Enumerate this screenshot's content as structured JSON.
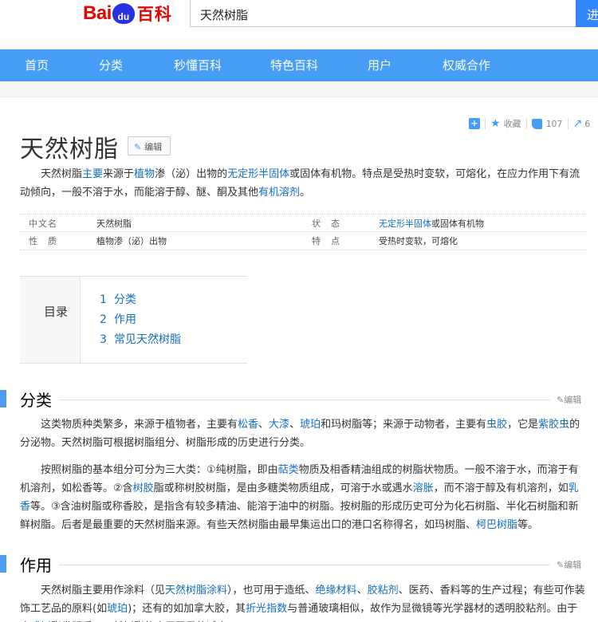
{
  "header": {
    "logo_bai": "Bai",
    "logo_du": "du",
    "logo_baike": "百科",
    "search_value": "天然树脂",
    "search_button": "进"
  },
  "nav": {
    "items": [
      "首页",
      "分类",
      "秒懂百科",
      "特色百科",
      "用户",
      "权威合作"
    ]
  },
  "toolbar": {
    "plus": "+",
    "collect": "收藏",
    "likes": "107",
    "shares": "6"
  },
  "article": {
    "title": "天然树脂",
    "edit": "编辑",
    "summary": [
      {
        "t": "天然树脂"
      },
      {
        "t": "主要",
        "link": true
      },
      {
        "t": "来源于"
      },
      {
        "t": "植物",
        "link": true
      },
      {
        "t": "渗（泌）出物的"
      },
      {
        "t": "无定形半固体",
        "link": true
      },
      {
        "t": "或固体有机物。特点是受热时变软，可熔化，在应力作用下有流动倾向，一般不溶于水，而能溶于醇、醚、酮及其他"
      },
      {
        "t": "有机溶剂",
        "link": true
      },
      {
        "t": "。"
      }
    ]
  },
  "basic_info": {
    "rows": [
      {
        "k1": "中文名",
        "v1": "天然树脂",
        "k2": "状　态",
        "v2_link": "无定形半固体",
        "v2_rest": "或固体有机物"
      },
      {
        "k1": "性　质",
        "v1": "植物渗（泌）出物",
        "k2": "特　点",
        "v2_link": "",
        "v2_rest": "受热时变软，可熔化"
      }
    ]
  },
  "catalog": {
    "title": "目录",
    "items": [
      {
        "num": "1",
        "label": "分类"
      },
      {
        "num": "2",
        "label": "作用"
      },
      {
        "num": "3",
        "label": "常见天然树脂"
      }
    ]
  },
  "sections": {
    "classification": {
      "title": "分类",
      "edit": "编辑",
      "p1": [
        {
          "t": "这类物质种类繁多，来源于植物者，主要有"
        },
        {
          "t": "松香",
          "link": true
        },
        {
          "t": "、"
        },
        {
          "t": "大漆",
          "link": true
        },
        {
          "t": "、"
        },
        {
          "t": "琥珀",
          "link": true
        },
        {
          "t": "和玛树脂等；来源于动物者，主要有"
        },
        {
          "t": "虫胶",
          "link": true
        },
        {
          "t": "，它是"
        },
        {
          "t": "紫胶虫",
          "link": true
        },
        {
          "t": "的分泌物。天然树脂可根据树脂组分、树脂形成的历史进行分类。"
        }
      ],
      "p2": [
        {
          "t": "按照树脂的基本组分可分为三大类：①纯树脂，即由"
        },
        {
          "t": "萜类",
          "link": true
        },
        {
          "t": "物质及相香精油组成的树脂状物质。一般不溶于水，而溶于有机溶剂，如松香等。②含"
        },
        {
          "t": "树胶",
          "link": true
        },
        {
          "t": "脂或称树胶树脂，是由多糖类物质组成，可溶于水或遇水"
        },
        {
          "t": "溶胀",
          "link": true
        },
        {
          "t": "，而不溶于醇及有机溶剂，如"
        },
        {
          "t": "乳香",
          "link": true
        },
        {
          "t": "等。③含油树脂或称香胶，是指含有较多精油、能溶于油中的树脂。按树脂的形成历史可分为化石树脂、半化石树脂和新鲜树脂。后者是最重要的天然树脂来源。有些天然树脂由最早集运出口的港口名称得名，如玛树脂、"
        },
        {
          "t": "柯巴树脂",
          "link": true
        },
        {
          "t": "等。"
        }
      ]
    },
    "usage": {
      "title": "作用",
      "edit": "编辑",
      "p1": [
        {
          "t": "天然树脂主要用作涂料（见"
        },
        {
          "t": "天然树脂涂料",
          "link": true
        },
        {
          "t": "），也可用于造纸、"
        },
        {
          "t": "绝缘材料",
          "link": true
        },
        {
          "t": "、"
        },
        {
          "t": "胶粘剂",
          "link": true
        },
        {
          "t": "、医药、香料等的生产过程；有些可作装饰工艺品的原料(如"
        },
        {
          "t": "琥珀",
          "link": true
        },
        {
          "t": ")；还有的如加拿大胶，其"
        },
        {
          "t": "折光指数",
          "link": true
        },
        {
          "t": "与普通玻璃相似，故作为显微镜等光学器材的透明胶粘剂。由于"
        },
        {
          "t": "合成树",
          "link": true
        },
        {
          "t": "脂发明后，天然树脂的应用已日趋减少。"
        }
      ]
    }
  }
}
